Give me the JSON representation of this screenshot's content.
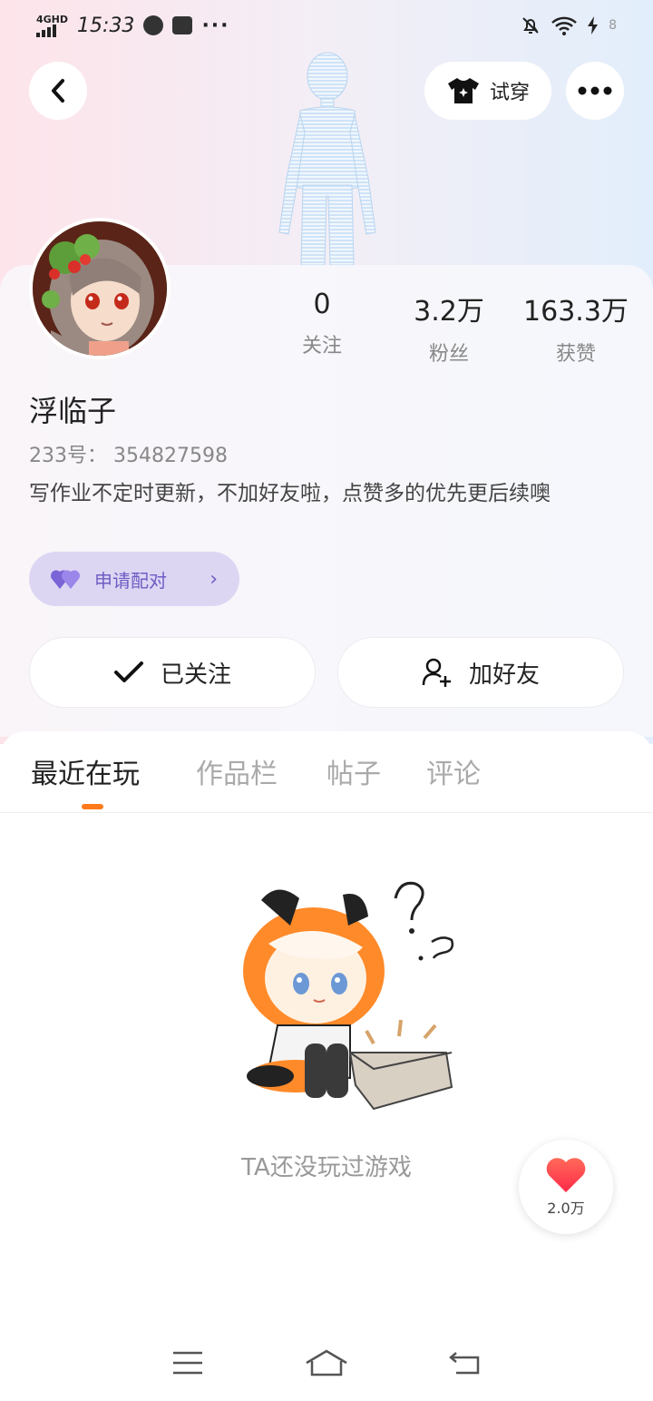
{
  "status_bar": {
    "network": "4GHD",
    "time": "15:33",
    "more": "···",
    "battery": "8"
  },
  "header": {
    "try_on_label": "试穿"
  },
  "profile": {
    "name": "浮临子",
    "id_label": "233号：",
    "id_value": "354827598",
    "bio": "写作业不定时更新，不加好友啦，点赞多的优先更后续噢",
    "stats": [
      {
        "value": "0",
        "label": "关注"
      },
      {
        "value": "3.2万",
        "label": "粉丝"
      },
      {
        "value": "163.3万",
        "label": "获赞"
      }
    ],
    "pair_label": "申请配对",
    "follow_label": "已关注",
    "add_friend_label": "加好友"
  },
  "tabs": [
    {
      "label": "最近在玩",
      "active": true
    },
    {
      "label": "作品栏",
      "active": false
    },
    {
      "label": "帖子",
      "active": false
    },
    {
      "label": "评论",
      "active": false
    }
  ],
  "empty_state": {
    "text": "TA还没玩过游戏"
  },
  "like_fab": {
    "count": "2.0万"
  },
  "colors": {
    "accent_orange": "#ff7a1a",
    "pair_purple": "#6f5cc4",
    "pair_bg": "#ddd6f3",
    "like_red": "#ff3b4a"
  }
}
